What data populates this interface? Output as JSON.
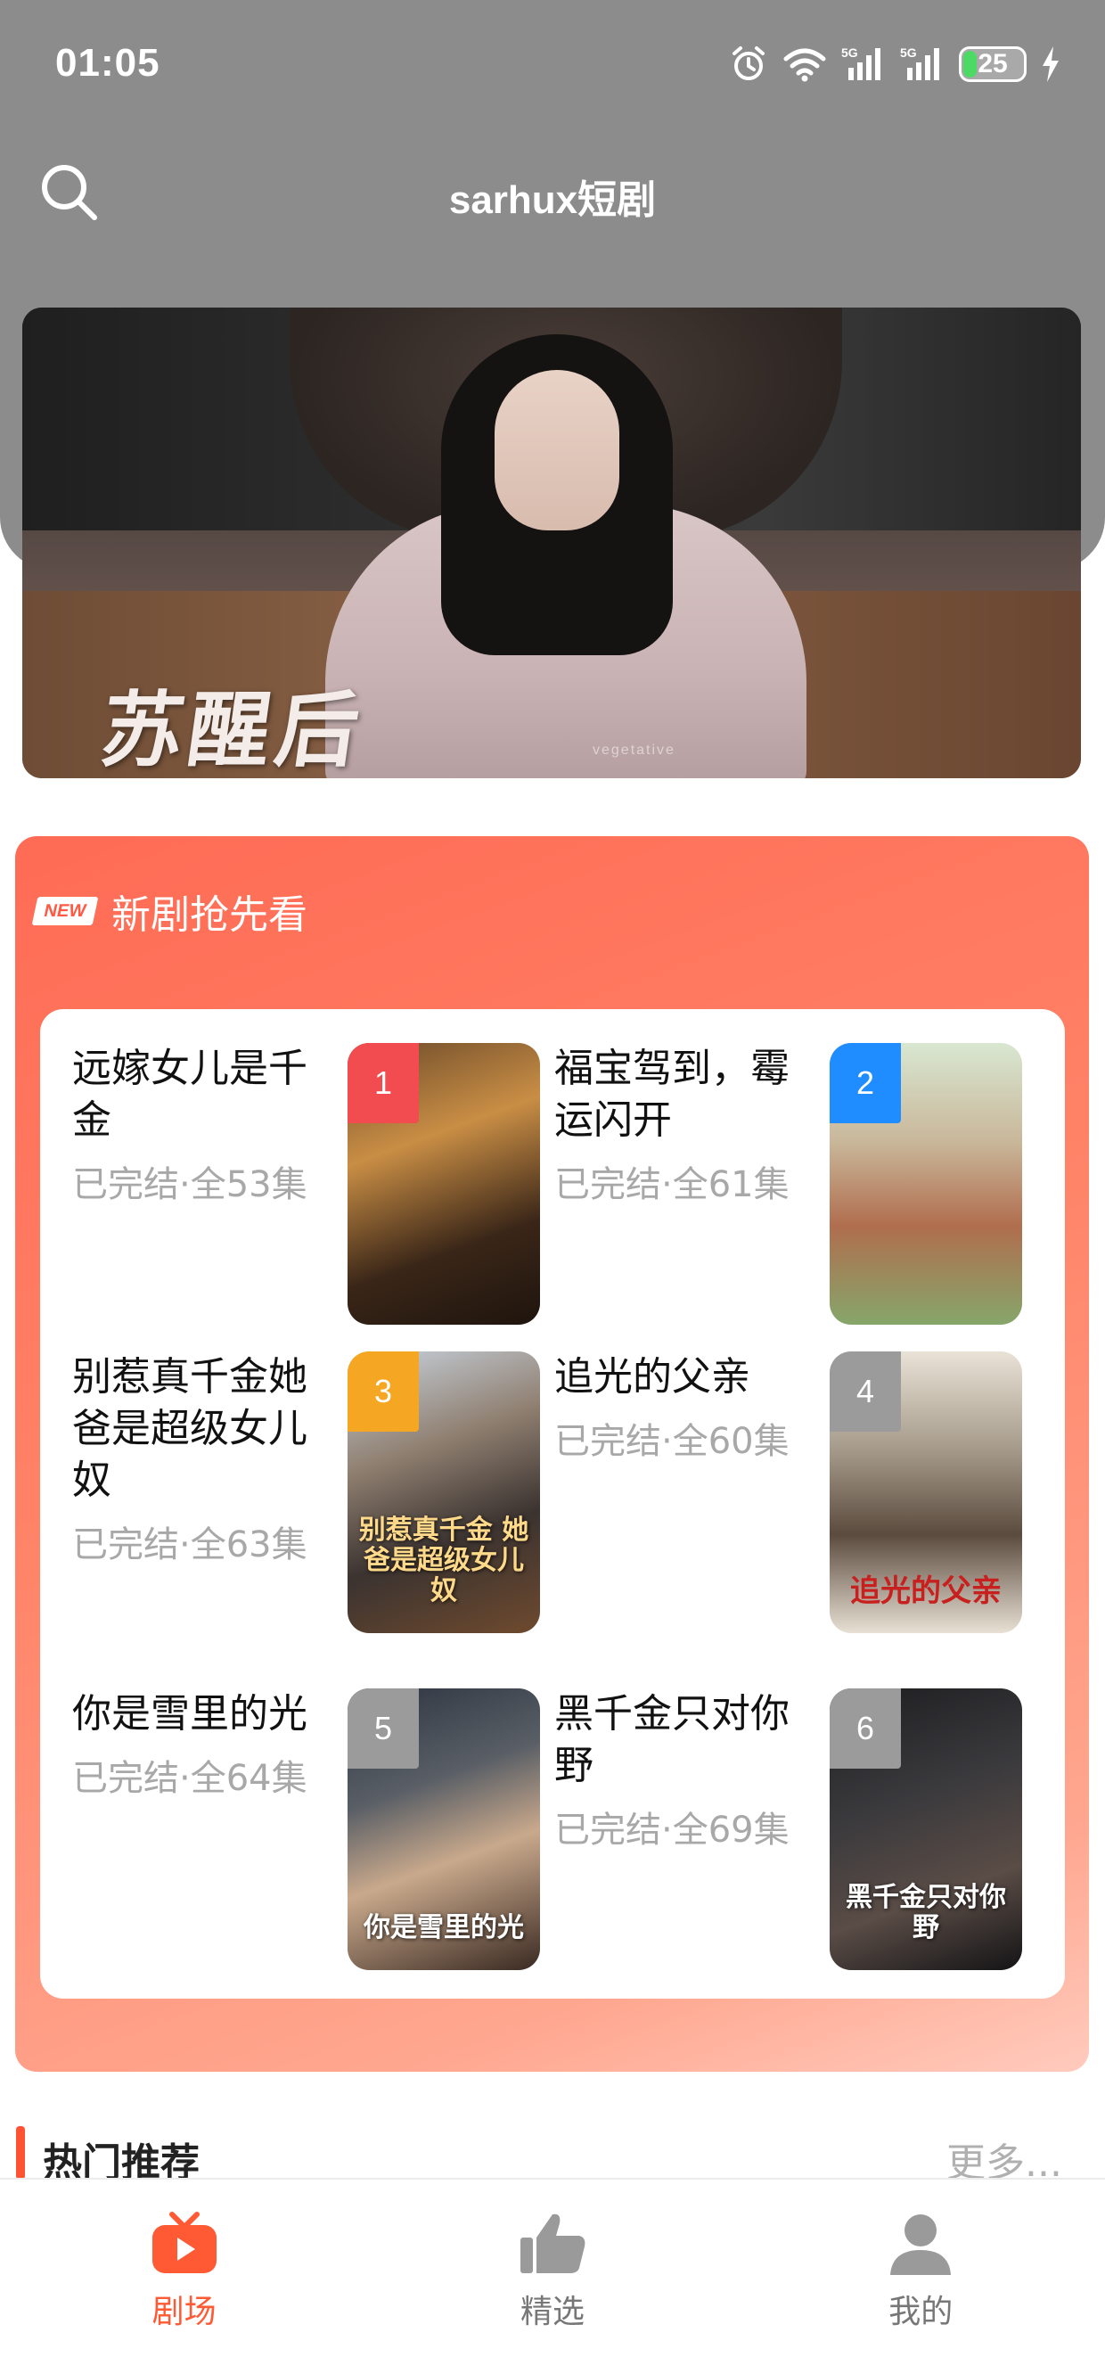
{
  "status_bar": {
    "time": "01:05",
    "battery": "25",
    "network_1": "5G",
    "network_2": "5G"
  },
  "header": {
    "title": "sarhux短剧",
    "search_icon": "search-icon"
  },
  "banner": {
    "title": "苏醒后",
    "subtitle": "vegetative"
  },
  "new_section": {
    "badge": "NEW",
    "title": "新剧抢先看",
    "items": [
      {
        "rank": "1",
        "title": "远嫁女儿是千金",
        "meta": "已完结·全53集",
        "rank_color": "#f24b50",
        "cover_caption": ""
      },
      {
        "rank": "2",
        "title": "福宝驾到，霉运闪开",
        "meta": "已完结·全61集",
        "rank_color": "#1f8cff",
        "cover_caption": ""
      },
      {
        "rank": "3",
        "title": "别惹真千金她爸是超级女儿奴",
        "meta": "已完结·全63集",
        "rank_color": "#f5a623",
        "cover_caption": "别惹真千金 她爸是超级女儿奴"
      },
      {
        "rank": "4",
        "title": "追光的父亲",
        "meta": "已完结·全60集",
        "rank_color": "#9b9b9b",
        "cover_caption": "追光的父亲"
      },
      {
        "rank": "5",
        "title": "你是雪里的光",
        "meta": "已完结·全64集",
        "rank_color": "#9b9b9b",
        "cover_caption": "你是雪里的光"
      },
      {
        "rank": "6",
        "title": "黑千金只对你野",
        "meta": "已完结·全69集",
        "rank_color": "#9b9b9b",
        "cover_caption": "黑千金只对你野"
      }
    ]
  },
  "hot_section": {
    "title": "热门推荐",
    "more": "更多..."
  },
  "bottom_nav": {
    "items": [
      {
        "label": "剧场",
        "icon": "tv-play-icon",
        "active": true
      },
      {
        "label": "精选",
        "icon": "thumbs-up-icon",
        "active": false
      },
      {
        "label": "我的",
        "icon": "user-icon",
        "active": false
      }
    ]
  },
  "colors": {
    "accent": "#ff5a33",
    "header_bg": "#8c8c8c",
    "section_gradient_start": "#ff6b55",
    "meta_text": "#a8a8a8"
  }
}
